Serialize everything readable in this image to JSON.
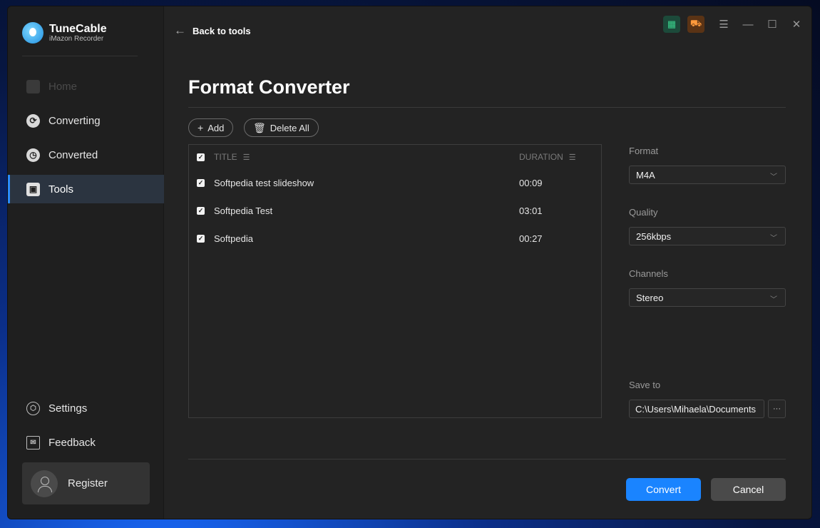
{
  "app": {
    "name": "TuneCable",
    "subtitle": "iMazon Recorder"
  },
  "sidebar": {
    "items": [
      {
        "label": "Home",
        "icon": "home-icon",
        "state": "disabled"
      },
      {
        "label": "Converting",
        "icon": "converting-icon",
        "state": "normal"
      },
      {
        "label": "Converted",
        "icon": "clock-icon",
        "state": "normal"
      },
      {
        "label": "Tools",
        "icon": "toolbox-icon",
        "state": "active"
      }
    ],
    "bottom": [
      {
        "label": "Settings",
        "icon": "gear-icon"
      },
      {
        "label": "Feedback",
        "icon": "mail-icon"
      }
    ],
    "register_label": "Register"
  },
  "topbar": {
    "back_label": "Back to tools"
  },
  "page": {
    "title": "Format Converter"
  },
  "toolbar": {
    "add_label": "Add",
    "delete_all_label": "Delete All"
  },
  "table": {
    "headers": {
      "title": "TITLE",
      "duration": "DURATION"
    },
    "rows": [
      {
        "title": "Softpedia test slideshow",
        "duration": "00:09",
        "checked": true
      },
      {
        "title": "Softpedia Test",
        "duration": "03:01",
        "checked": true
      },
      {
        "title": "Softpedia",
        "duration": "00:27",
        "checked": true
      }
    ]
  },
  "settings": {
    "format": {
      "label": "Format",
      "value": "M4A"
    },
    "quality": {
      "label": "Quality",
      "value": "256kbps"
    },
    "channels": {
      "label": "Channels",
      "value": "Stereo"
    },
    "save_to": {
      "label": "Save to",
      "value": "C:\\Users\\Mihaela\\Documents"
    }
  },
  "actions": {
    "convert_label": "Convert",
    "cancel_label": "Cancel"
  },
  "colors": {
    "accent": "#1a84ff",
    "background": "#232323",
    "sidebar": "#1f1f1f"
  }
}
